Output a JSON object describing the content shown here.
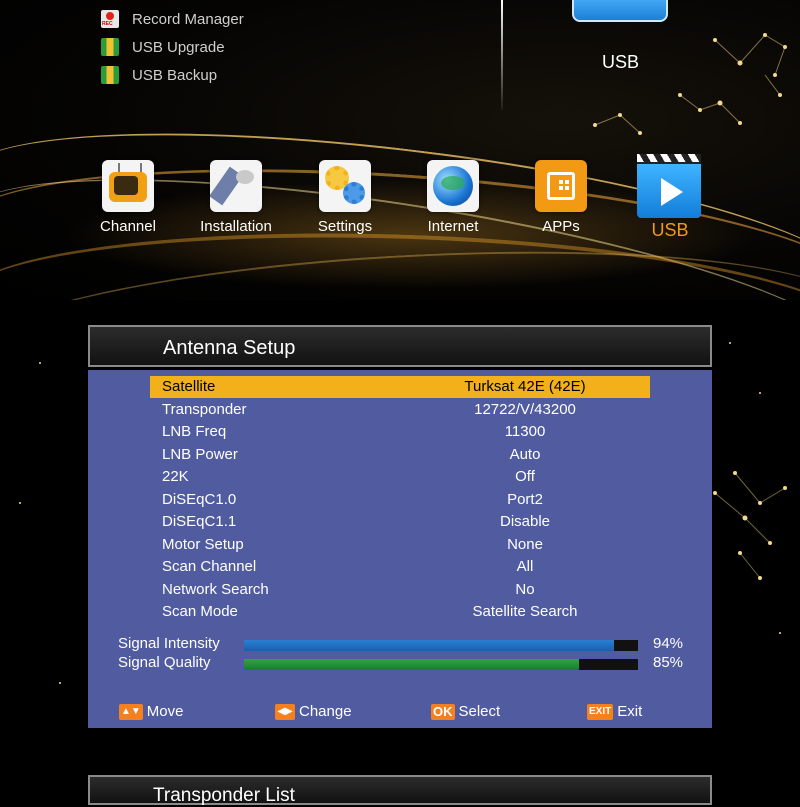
{
  "top_menu": {
    "submenu": [
      {
        "label": "Record Manager",
        "icon": "record-icon"
      },
      {
        "label": "USB Upgrade",
        "icon": "usb-upgrade-icon"
      },
      {
        "label": "USB Backup",
        "icon": "usb-backup-icon"
      }
    ],
    "usb_header_label": "USB",
    "items": [
      {
        "label": "Channel",
        "icon": "tv-icon"
      },
      {
        "label": "Installation",
        "icon": "satellite-icon"
      },
      {
        "label": "Settings",
        "icon": "gears-icon"
      },
      {
        "label": "Internet",
        "icon": "globe-icon"
      },
      {
        "label": "APPs",
        "icon": "store-bag-icon"
      },
      {
        "label": "USB",
        "icon": "video-play-icon",
        "selected": true
      }
    ],
    "selected_color": "#f29a13"
  },
  "antenna_setup": {
    "title": "Antenna Setup",
    "rows": [
      {
        "label": "Satellite",
        "value": "Turksat 42E (42E)",
        "selected": true
      },
      {
        "label": "Transponder",
        "value": "12722/V/43200"
      },
      {
        "label": "LNB Freq",
        "value": "11300"
      },
      {
        "label": "LNB Power",
        "value": "Auto"
      },
      {
        "label": "22K",
        "value": "Off"
      },
      {
        "label": "DiSEqC1.0",
        "value": "Port2"
      },
      {
        "label": "DiSEqC1.1",
        "value": "Disable"
      },
      {
        "label": "Motor Setup",
        "value": "None"
      },
      {
        "label": "Scan Channel",
        "value": "All"
      },
      {
        "label": "Network Search",
        "value": "No"
      },
      {
        "label": "Scan Mode",
        "value": "Satellite Search"
      }
    ],
    "signal": {
      "intensity_label": "Signal Intensity",
      "intensity_percent": "94%",
      "intensity_value": 94,
      "intensity_color": "#2a7fd2",
      "quality_label": "Signal Quality",
      "quality_percent": "85%",
      "quality_value": 85,
      "quality_color": "#2fa542"
    },
    "hints": [
      {
        "key": "up-down-arrow-key-icon",
        "label": "Move"
      },
      {
        "key": "four-way-arrow-key-icon",
        "label": "Change"
      },
      {
        "key_text": "OK",
        "label": "Select"
      },
      {
        "key_text": "EXIT",
        "label": "Exit"
      }
    ],
    "panel_color": "#505ba0",
    "highlight_color": "#f2b01a"
  },
  "transponder_list": {
    "title": "Transponder List"
  }
}
